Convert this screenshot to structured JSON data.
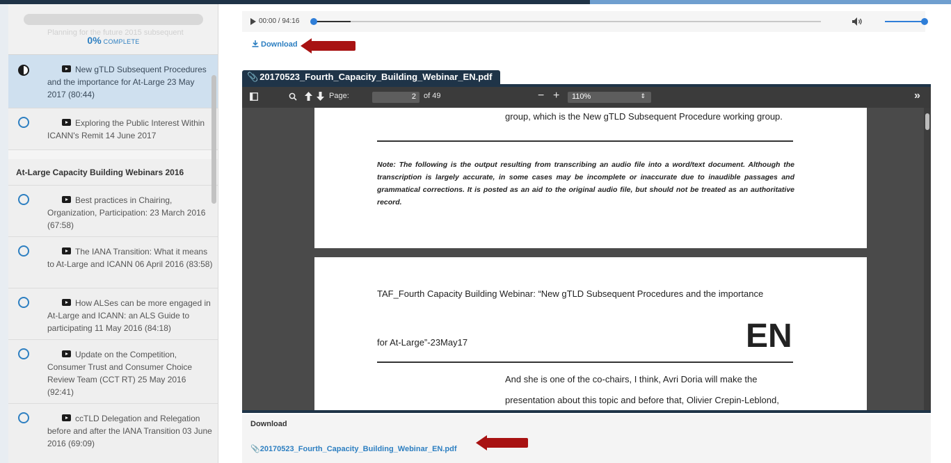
{
  "sidebar": {
    "progress": {
      "percent": 0,
      "percent_text": "0%",
      "complete_label": "COMPLETE",
      "ghost_text": "Planning for the future 2015 subsequent"
    },
    "lessons_top": [
      {
        "title": "New gTLD Subsequent Procedures and the importance for At-Large 23 May 2017 (80:44)",
        "state": "in-progress",
        "active": true
      },
      {
        "title": "Exploring the Public Interest Within ICANN's Remit 14 June 2017",
        "state": "not-started",
        "active": false
      }
    ],
    "section_title": "At-Large Capacity Building Webinars 2016",
    "lessons_2016": [
      {
        "title": "Best practices in Chairing, Organization, Participation: 23 March 2016 (67:58)",
        "state": "not-started"
      },
      {
        "title": "The IANA Transition: What it means to At-Large and ICANN 06 April 2016 (83:58)",
        "state": "not-started"
      },
      {
        "title": "How ALSes can be more engaged in At-Large and ICANN: an ALS Guide to participating 11 May 2016 (84:18)",
        "state": "not-started"
      },
      {
        "title": "Update on the Competition, Consumer Trust and Consumer Choice Review Team (CCT RT) 25 May 2016 (92:41)",
        "state": "not-started"
      },
      {
        "title": "ccTLD Delegation and Relegation before and after the IANA Transition 03 June 2016 (69:09)",
        "state": "not-started"
      }
    ]
  },
  "audio": {
    "time": "00:00 / 94:16",
    "played_fraction": 0,
    "volume_fraction": 1
  },
  "download_top": "Download",
  "file_tab": "20170523_Fourth_Capacity_Building_Webinar_EN.pdf",
  "viewer": {
    "page_label": "Page:",
    "page_number": "2",
    "page_total": "of 49",
    "zoom": "110%",
    "page1_text": "group, which is the New gTLD Subsequent Procedure working group.",
    "note": "Note: The following is the output resulting from transcribing an audio file into a word/text document. Although the transcription is largely accurate, in some cases may be incomplete or inaccurate due to inaudible passages and grammatical corrections. It is posted as an aid to the original audio file, but should not be treated as an authoritative record.",
    "page2_title_line1": "TAF_Fourth Capacity Building Webinar: “New gTLD Subsequent Procedures and the importance",
    "page2_title_line2": "for At-Large”-23May17",
    "page2_lang": "EN",
    "page2_body_line1": "And she is one of the co-chairs, I think, Avri Doria will make the",
    "page2_body_line2": "presentation about this topic and before that, Olivier Crepin-Leblond,"
  },
  "download_section": {
    "title": "Download",
    "file_link": "20170523_Fourth_Capacity_Building_Webinar_EN.pdf"
  },
  "colors": {
    "accent": "#2d7fc1",
    "dark_navy": "#1f3448",
    "arrow_red": "#a81212"
  }
}
